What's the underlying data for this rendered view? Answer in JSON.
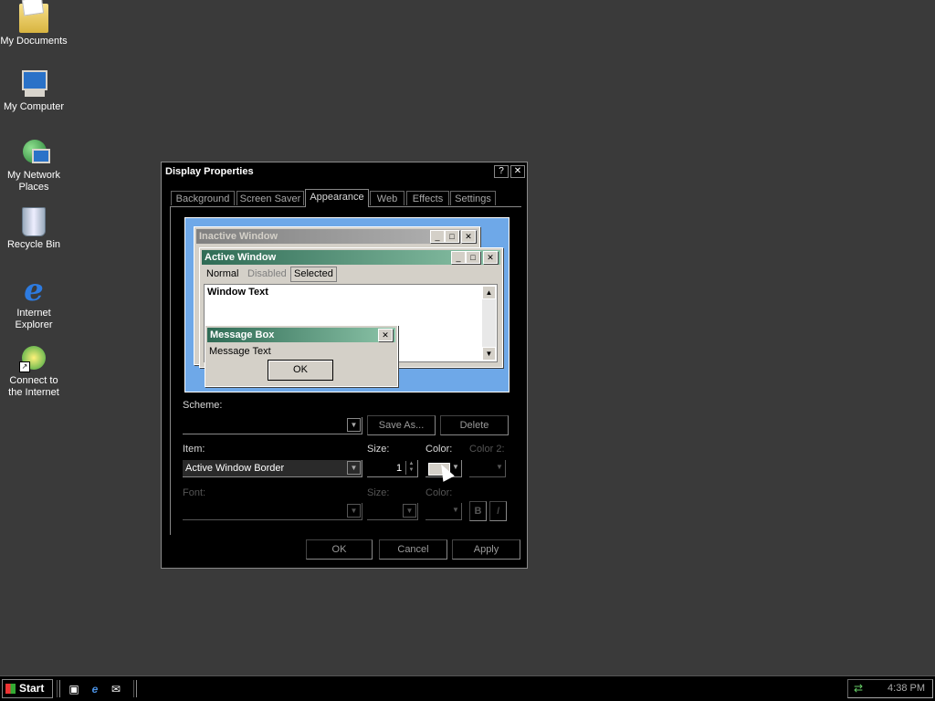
{
  "desktop": {
    "icons": [
      {
        "label": "My Documents"
      },
      {
        "label": "My Computer"
      },
      {
        "label": "My Network Places"
      },
      {
        "label": "Recycle Bin"
      },
      {
        "label": "Internet Explorer"
      },
      {
        "label": "Connect to the Internet"
      }
    ]
  },
  "dialog": {
    "title": "Display Properties",
    "help_glyph": "?",
    "close_glyph": "✕",
    "tabs": [
      "Background",
      "Screen Saver",
      "Appearance",
      "Web",
      "Effects",
      "Settings"
    ],
    "active_tab": "Appearance",
    "preview": {
      "inactive_title": "Inactive Window",
      "active_title": "Active Window",
      "menu_normal": "Normal",
      "menu_disabled": "Disabled",
      "menu_selected": "Selected",
      "window_text": "Window Text",
      "message_title": "Message Box",
      "message_text": "Message Text",
      "ok_label": "OK"
    },
    "scheme": {
      "label": "Scheme:",
      "value": "",
      "save_as": "Save As...",
      "delete": "Delete"
    },
    "item": {
      "label": "Item:",
      "value": "Active Window Border",
      "size_label": "Size:",
      "size_value": "1",
      "color_label": "Color:",
      "color2_label": "Color 2:",
      "color_value": "#d4d0c8"
    },
    "font": {
      "label": "Font:",
      "size_label": "Size:",
      "color_label": "Color:",
      "bold": "B",
      "italic": "I"
    },
    "buttons": {
      "ok": "OK",
      "cancel": "Cancel",
      "apply": "Apply"
    }
  },
  "taskbar": {
    "start_label": "Start",
    "clock": "4:38 PM"
  }
}
